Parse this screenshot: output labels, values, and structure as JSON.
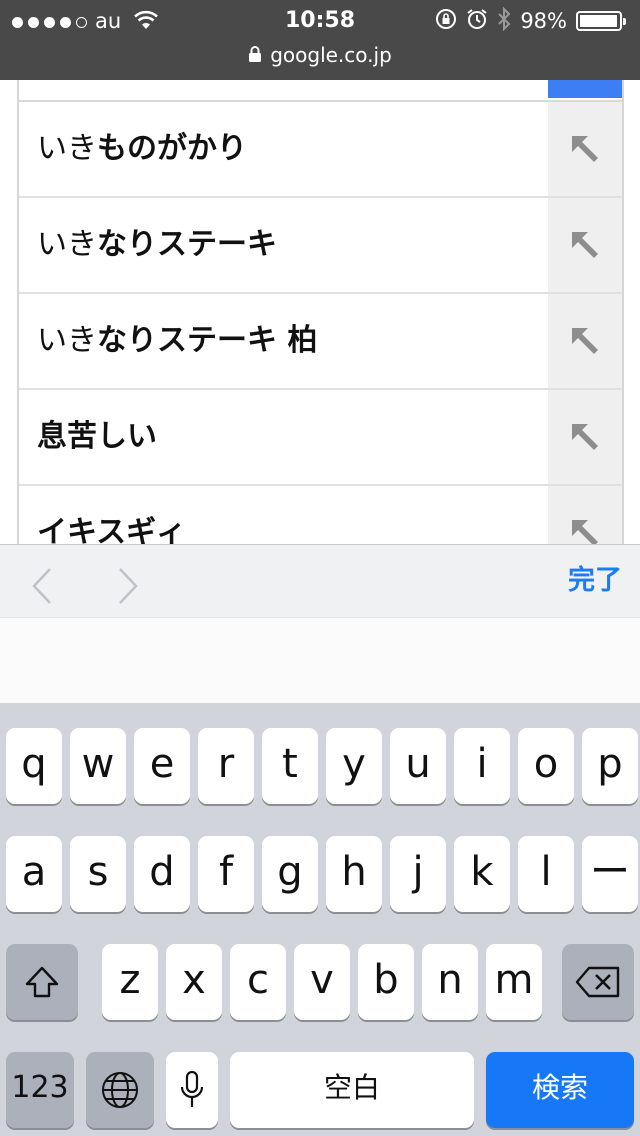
{
  "status_bar": {
    "carrier": "au",
    "signal_dots": 5,
    "signal_filled": 4,
    "time": "10:58",
    "battery_percent": "98%",
    "battery_level": 0.98,
    "url": "google.co.jp",
    "icons": [
      "wifi-icon",
      "rotation-lock-icon",
      "alarm-icon",
      "bluetooth-icon",
      "battery-icon",
      "lock-icon"
    ]
  },
  "suggestions": [
    {
      "prefix": "いき",
      "rest": "ものがかり"
    },
    {
      "prefix": "いき",
      "rest": "なりステーキ"
    },
    {
      "prefix": "いき",
      "rest": "なりステーキ 柏"
    },
    {
      "prefix": "",
      "rest": "息苦しい"
    },
    {
      "prefix": "",
      "rest": "イキスギィ"
    }
  ],
  "toolbar": {
    "done_label": "完了",
    "icons": [
      "chevron-left-icon",
      "chevron-right-icon"
    ]
  },
  "keyboard": {
    "row1": [
      "q",
      "w",
      "e",
      "r",
      "t",
      "y",
      "u",
      "i",
      "o",
      "p"
    ],
    "row2": [
      "a",
      "s",
      "d",
      "f",
      "g",
      "h",
      "j",
      "k",
      "l",
      "ー"
    ],
    "row3": [
      "z",
      "x",
      "c",
      "v",
      "b",
      "n",
      "m"
    ],
    "numbers_label": "123",
    "space_label": "空白",
    "search_label": "検索",
    "colors": {
      "search_key": "#1677f7",
      "done_text": "#1b7cf5"
    }
  }
}
